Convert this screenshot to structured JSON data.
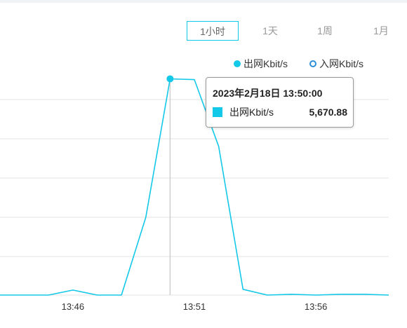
{
  "range_tabs": [
    {
      "label": "1小时",
      "active": true
    },
    {
      "label": "1天",
      "active": false
    },
    {
      "label": "1周",
      "active": false
    },
    {
      "label": "1月",
      "active": false
    }
  ],
  "colors": {
    "series_out": "#14c8e8",
    "series_in": "#2c8fd8",
    "grid": "#e3e3e3",
    "axis_text": "#333333",
    "cursor": "#cfcfcf"
  },
  "chart_data": {
    "type": "line",
    "x": [
      "13:43",
      "13:44",
      "13:45",
      "13:46",
      "13:47",
      "13:48",
      "13:49",
      "13:50",
      "13:51",
      "13:52",
      "13:53",
      "13:54",
      "13:55",
      "13:56",
      "13:57",
      "13:58",
      "13:59"
    ],
    "x_ticks": [
      "13:46",
      "13:51",
      "13:56"
    ],
    "grid": true,
    "legend_position": "top-right",
    "series": [
      {
        "name": "出网Kbit/s",
        "values": [
          0,
          0,
          0,
          130,
          0,
          0,
          2040,
          5670.88,
          5650,
          3900,
          150,
          0,
          20,
          0,
          20,
          20,
          0
        ]
      },
      {
        "name": "入网Kbit/s",
        "values": []
      }
    ],
    "tooltip": {
      "title": "2023年2月18日 13:50:00",
      "series": "出网Kbit/s",
      "value": "5,670.88",
      "index": 7
    }
  }
}
